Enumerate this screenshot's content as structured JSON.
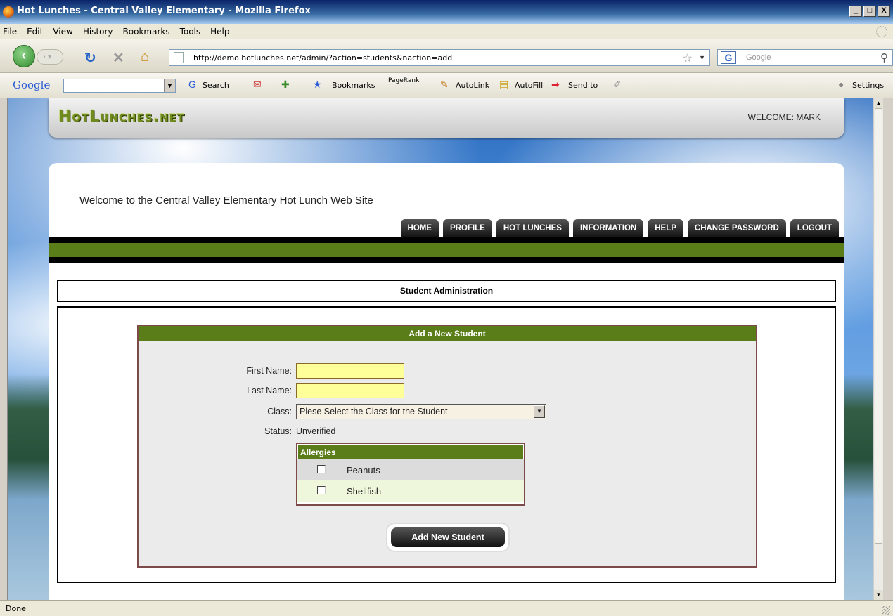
{
  "window": {
    "title": "Hot Lunches - Central Valley Elementary - Mozilla Firefox",
    "minimize": "_",
    "maximize": "□",
    "close": "X"
  },
  "menu": [
    "File",
    "Edit",
    "View",
    "History",
    "Bookmarks",
    "Tools",
    "Help"
  ],
  "navbar": {
    "url": "http://demo.hotlunches.net/admin/?action=students&naction=add",
    "search_placeholder": "Google"
  },
  "google_toolbar": {
    "logo": "Google",
    "search": "Search",
    "bookmarks": "Bookmarks",
    "pagerank": "PageRank",
    "autolink": "AutoLink",
    "autofill": "AutoFill",
    "sendto": "Send to",
    "settings": "Settings"
  },
  "site": {
    "logo": "HotLunches.net",
    "welcome_user": "WELCOME: MARK",
    "greeting": "Welcome to the Central Valley Elementary Hot Lunch Web Site",
    "tabs": [
      "HOME",
      "PROFILE",
      "HOT LUNCHES",
      "INFORMATION",
      "HELP",
      "CHANGE PASSWORD",
      "LOGOUT"
    ]
  },
  "admin": {
    "section_title": "Student Administration",
    "form_title": "Add a New Student",
    "first_name_label": "First Name:",
    "first_name_value": "",
    "last_name_label": "Last Name:",
    "last_name_value": "",
    "class_label": "Class:",
    "class_selected": "Plese Select the Class for the Student",
    "status_label": "Status:",
    "status_value": "Unverified",
    "allergies_title": "Allergies",
    "allergies": [
      {
        "label": "Peanuts",
        "checked": false
      },
      {
        "label": "Shellfish",
        "checked": false
      }
    ],
    "submit_label": "Add New Student"
  },
  "statusbar": {
    "text": "Done"
  },
  "colors": {
    "accent_green": "#5a7d1a",
    "input_yellow": "#ffff99",
    "form_border": "#7d4a4a"
  }
}
